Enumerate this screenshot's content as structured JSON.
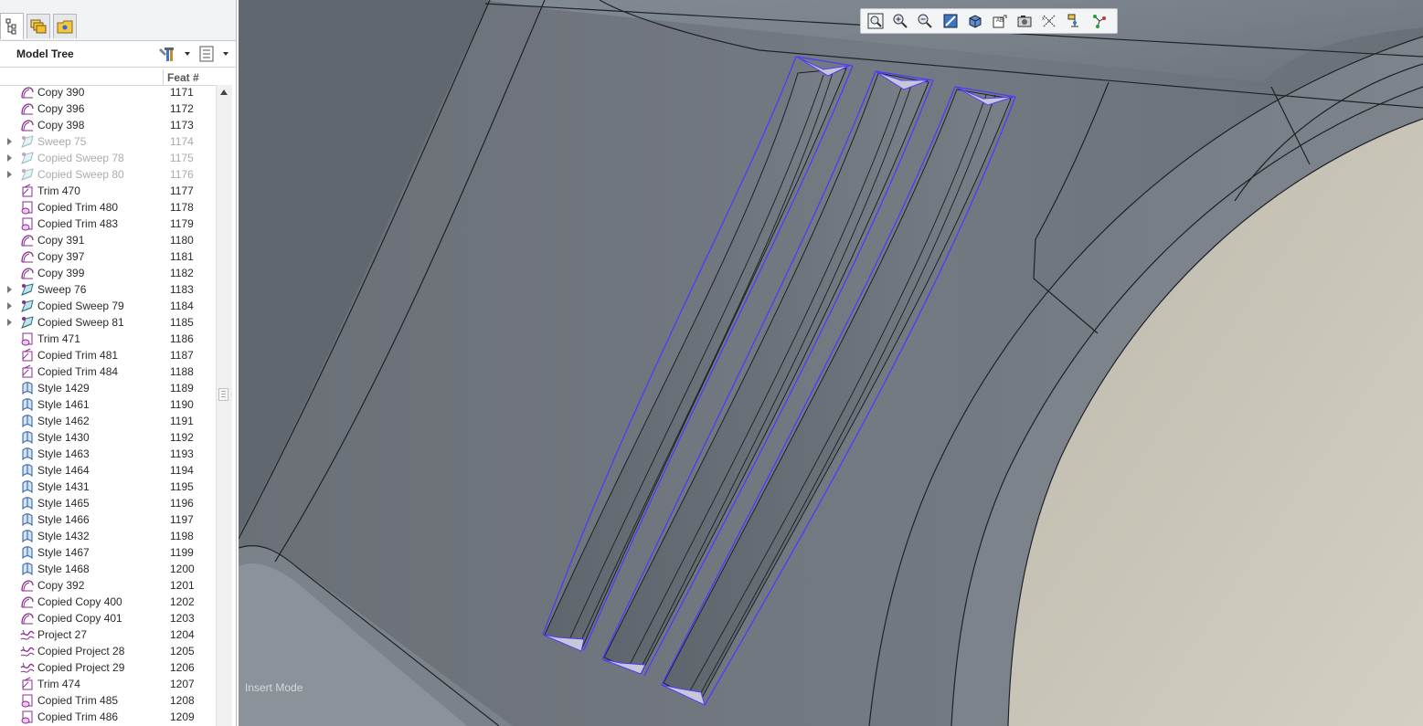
{
  "tabs": [
    {
      "name": "model-tree-tab",
      "icon": "model-tree-icon"
    },
    {
      "name": "layers-tab",
      "icon": "layers-icon"
    },
    {
      "name": "folder-browser-tab",
      "icon": "folder-icon"
    }
  ],
  "tree": {
    "title": "Model Tree",
    "settings_icon": "tools-icon",
    "show_icon": "list-icon",
    "column_feat": "Feat #",
    "rows": [
      {
        "label": "Copy 390",
        "feat": "1171",
        "icon": "copy",
        "expandable": false,
        "suppressed": false
      },
      {
        "label": "Copy 396",
        "feat": "1172",
        "icon": "copy",
        "expandable": false,
        "suppressed": false
      },
      {
        "label": "Copy 398",
        "feat": "1173",
        "icon": "copy",
        "expandable": false,
        "suppressed": false
      },
      {
        "label": "Sweep 75",
        "feat": "1174",
        "icon": "sweep",
        "expandable": true,
        "suppressed": true
      },
      {
        "label": "Copied Sweep 78",
        "feat": "1175",
        "icon": "sweep",
        "expandable": true,
        "suppressed": true
      },
      {
        "label": "Copied Sweep 80",
        "feat": "1176",
        "icon": "sweep",
        "expandable": true,
        "suppressed": true
      },
      {
        "label": "Trim 470",
        "feat": "1177",
        "icon": "trim",
        "expandable": false,
        "suppressed": false
      },
      {
        "label": "Copied Trim 480",
        "feat": "1178",
        "icon": "copied-trim",
        "expandable": false,
        "suppressed": false
      },
      {
        "label": "Copied Trim 483",
        "feat": "1179",
        "icon": "copied-trim",
        "expandable": false,
        "suppressed": false
      },
      {
        "label": "Copy 391",
        "feat": "1180",
        "icon": "copy",
        "expandable": false,
        "suppressed": false
      },
      {
        "label": "Copy 397",
        "feat": "1181",
        "icon": "copy",
        "expandable": false,
        "suppressed": false
      },
      {
        "label": "Copy 399",
        "feat": "1182",
        "icon": "copy",
        "expandable": false,
        "suppressed": false
      },
      {
        "label": "Sweep 76",
        "feat": "1183",
        "icon": "sweep",
        "expandable": true,
        "suppressed": false
      },
      {
        "label": "Copied Sweep 79",
        "feat": "1184",
        "icon": "sweep",
        "expandable": true,
        "suppressed": false
      },
      {
        "label": "Copied Sweep 81",
        "feat": "1185",
        "icon": "sweep",
        "expandable": true,
        "suppressed": false
      },
      {
        "label": "Trim 471",
        "feat": "1186",
        "icon": "copied-trim",
        "expandable": false,
        "suppressed": false
      },
      {
        "label": "Copied Trim 481",
        "feat": "1187",
        "icon": "trim",
        "expandable": false,
        "suppressed": false
      },
      {
        "label": "Copied Trim 484",
        "feat": "1188",
        "icon": "trim",
        "expandable": false,
        "suppressed": false
      },
      {
        "label": "Style 1429",
        "feat": "1189",
        "icon": "style",
        "expandable": false,
        "suppressed": false
      },
      {
        "label": "Style 1461",
        "feat": "1190",
        "icon": "style",
        "expandable": false,
        "suppressed": false
      },
      {
        "label": "Style 1462",
        "feat": "1191",
        "icon": "style",
        "expandable": false,
        "suppressed": false
      },
      {
        "label": "Style 1430",
        "feat": "1192",
        "icon": "style",
        "expandable": false,
        "suppressed": false
      },
      {
        "label": "Style 1463",
        "feat": "1193",
        "icon": "style",
        "expandable": false,
        "suppressed": false
      },
      {
        "label": "Style 1464",
        "feat": "1194",
        "icon": "style",
        "expandable": false,
        "suppressed": false
      },
      {
        "label": "Style 1431",
        "feat": "1195",
        "icon": "style",
        "expandable": false,
        "suppressed": false
      },
      {
        "label": "Style 1465",
        "feat": "1196",
        "icon": "style",
        "expandable": false,
        "suppressed": false
      },
      {
        "label": "Style 1466",
        "feat": "1197",
        "icon": "style",
        "expandable": false,
        "suppressed": false
      },
      {
        "label": "Style 1432",
        "feat": "1198",
        "icon": "style",
        "expandable": false,
        "suppressed": false
      },
      {
        "label": "Style 1467",
        "feat": "1199",
        "icon": "style",
        "expandable": false,
        "suppressed": false
      },
      {
        "label": "Style 1468",
        "feat": "1200",
        "icon": "style",
        "expandable": false,
        "suppressed": false
      },
      {
        "label": "Copy 392",
        "feat": "1201",
        "icon": "copy",
        "expandable": false,
        "suppressed": false
      },
      {
        "label": "Copied Copy 400",
        "feat": "1202",
        "icon": "copy",
        "expandable": false,
        "suppressed": false
      },
      {
        "label": "Copied Copy 401",
        "feat": "1203",
        "icon": "copy",
        "expandable": false,
        "suppressed": false
      },
      {
        "label": "Project 27",
        "feat": "1204",
        "icon": "project",
        "expandable": false,
        "suppressed": false
      },
      {
        "label": "Copied Project 28",
        "feat": "1205",
        "icon": "project",
        "expandable": false,
        "suppressed": false
      },
      {
        "label": "Copied Project 29",
        "feat": "1206",
        "icon": "project",
        "expandable": false,
        "suppressed": false
      },
      {
        "label": "Trim 474",
        "feat": "1207",
        "icon": "trim",
        "expandable": false,
        "suppressed": false
      },
      {
        "label": "Copied Trim 485",
        "feat": "1208",
        "icon": "copied-trim",
        "expandable": false,
        "suppressed": false
      },
      {
        "label": "Copied Trim 486",
        "feat": "1209",
        "icon": "copied-trim",
        "expandable": false,
        "suppressed": false
      }
    ]
  },
  "view_toolbar": [
    "refit-icon",
    "zoom-in-icon",
    "zoom-out-icon",
    "repaint-icon",
    "display-style-icon",
    "saved-orientations-icon",
    "view-manager-icon",
    "datum-display-icon",
    "spin-center-icon",
    "annotation-display-icon"
  ],
  "viewport": {
    "mode": "Insert Mode",
    "colors": {
      "surface": "#6e747b",
      "highlight": "#4a3cff",
      "face_beige": "#cfcbbf"
    }
  }
}
